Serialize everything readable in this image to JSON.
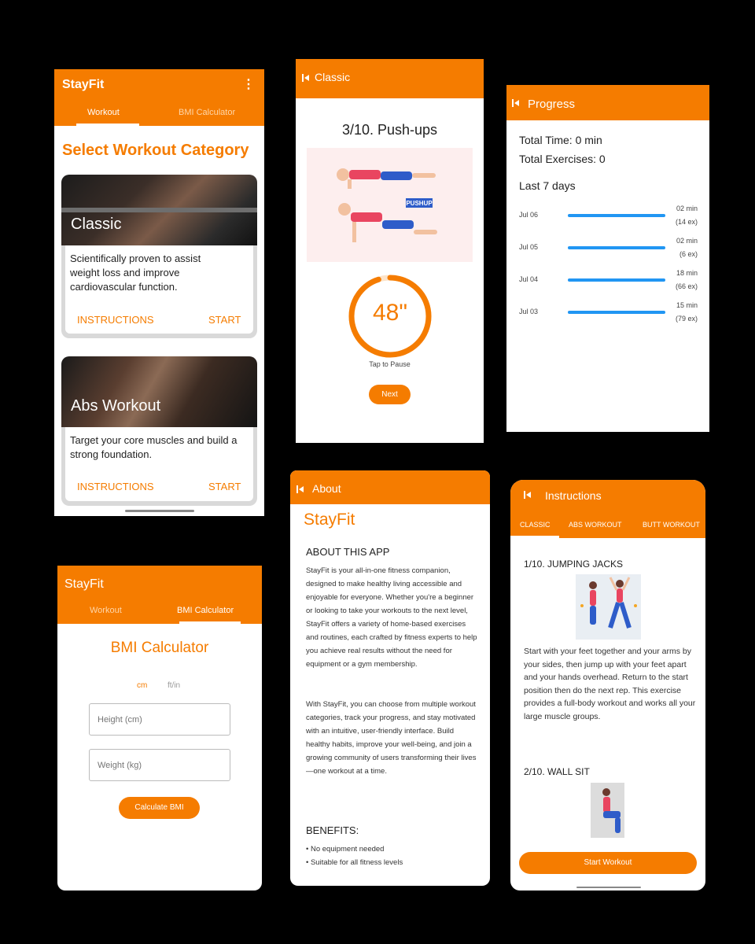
{
  "home": {
    "app_title": "StayFit",
    "tabs": [
      "Workout",
      "BMI Calculator"
    ],
    "heading": "Select Workout Category",
    "cards": [
      {
        "title": "Classic",
        "desc": "Scientifically proven to assist weight loss and improve cardiovascular function.",
        "instructions": "INSTRUCTIONS",
        "start": "START"
      },
      {
        "title": "Abs Workout",
        "desc": "Target your core muscles and build a strong foundation.",
        "instructions": "INSTRUCTIONS",
        "start": "START"
      }
    ]
  },
  "exercise": {
    "title": "Classic",
    "name": "3/10. Push-ups",
    "badge": "PUSHUP",
    "timer": "48\"",
    "timer_progress": 0.95,
    "hint": "Tap to Pause",
    "next": "Next"
  },
  "progress": {
    "title": "Progress",
    "total_time": "Total Time: 0 min",
    "total_ex": "Total Exercises: 0",
    "last_days": "Last 7 days",
    "rows": [
      {
        "date": "Jul 06",
        "min": "02 min",
        "ex": "(14 ex)"
      },
      {
        "date": "Jul 05",
        "min": "02 min",
        "ex": "(6 ex)"
      },
      {
        "date": "Jul 04",
        "min": "18 min",
        "ex": "(66 ex)"
      },
      {
        "date": "Jul 03",
        "min": "15 min",
        "ex": "(79 ex)"
      }
    ]
  },
  "bmi": {
    "app_title": "StayFit",
    "tabs": [
      "Workout",
      "BMI Calculator"
    ],
    "heading": "BMI Calculator",
    "units": [
      "cm",
      "ft/in"
    ],
    "height_placeholder": "Height (cm)",
    "weight_placeholder": "Weight (kg)",
    "calculate": "Calculate BMI"
  },
  "about": {
    "title": "About",
    "brand": "StayFit",
    "section1": "ABOUT THIS APP",
    "p1": "StayFit is your all-in-one fitness companion, designed to make healthy living accessible and enjoyable for everyone. Whether you're a beginner or looking to take your workouts to the next level, StayFit offers a variety of home-based exercises and routines, each crafted by fitness experts to help you achieve real results without the need for equipment or a gym membership.",
    "p2": "With StayFit, you can choose from multiple workout categories, track your progress, and stay motivated with an intuitive, user-friendly interface. Build healthy habits, improve your well-being, and join a growing community of users transforming their lives—one workout at a time.",
    "section2": "BENEFITS:",
    "benefits": [
      "• No equipment needed",
      "• Suitable for all fitness levels"
    ]
  },
  "instructions": {
    "title": "Instructions",
    "tabs": [
      "CLASSIC",
      "ABS WORKOUT",
      "BUTT WORKOUT"
    ],
    "ex1_title": "1/10. JUMPING JACKS",
    "ex1_desc": "Start with your feet together and your arms by your sides, then jump up with your feet apart and your hands overhead. Return to the start position then do the next rep. This exercise provides a full-body workout and works all your large muscle groups.",
    "ex2_title": "2/10. WALL SIT",
    "start": "Start Workout"
  },
  "colors": {
    "accent": "#f57c00",
    "bar": "#2196f3"
  }
}
